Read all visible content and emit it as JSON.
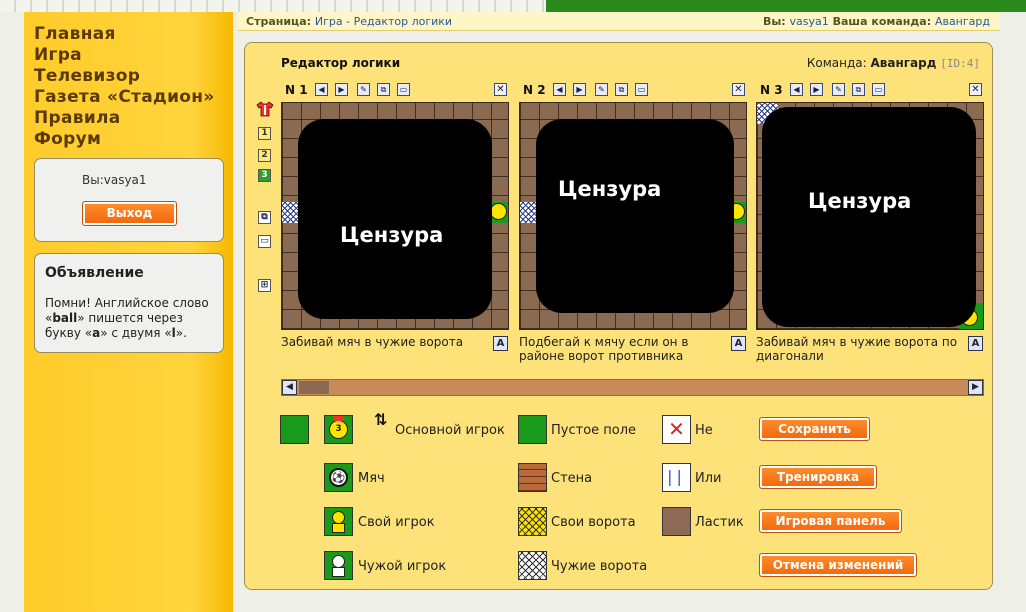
{
  "nav": [
    "Главная",
    "Игра",
    "Телевизор",
    "Газета «Стадион»",
    "Правила",
    "Форум"
  ],
  "user_panel": {
    "username": "Вы:vasya1",
    "logout_label": "Выход"
  },
  "announcement": {
    "title": "Объявление",
    "text_a": "Помни! Английское слово «",
    "text_b": "ball",
    "text_c": "» пишется через букву «",
    "text_d": "a",
    "text_e": "» с двумя «",
    "text_f": "l",
    "text_g": "»."
  },
  "header": {
    "page_label": "Страница:",
    "page_value": "Игра - Редактор логики",
    "you_label": "Вы:",
    "you_value": "vasya1",
    "team_label": "Ваша команда:",
    "team_value": "Авангард"
  },
  "editor": {
    "title": "Редактор логики",
    "team_label": "Команда:",
    "team_name": "Авангард",
    "team_id": "[ID:4]"
  },
  "side_tools": {
    "levels": [
      "1",
      "2",
      "3"
    ],
    "active_level": "3"
  },
  "cards": [
    {
      "number": "N 1",
      "censor": "Цензура",
      "description": "Забивай мяч в чужие ворота"
    },
    {
      "number": "N 2",
      "censor": "Цензура",
      "description": "Подбегай к мячу если он в районе ворот противника"
    },
    {
      "number": "N 3",
      "censor": "Цензура",
      "description": "Забивай мяч в чужие ворота по диагонали"
    }
  ],
  "palette": {
    "main_player": "Основной игрок",
    "ball": "Мяч",
    "own_player": "Свой игрок",
    "enemy_player": "Чужой игрок",
    "empty_field": "Пустое поле",
    "wall": "Стена",
    "own_goal": "Свои ворота",
    "enemy_goal": "Чужие ворота",
    "not": "Не",
    "or": "Или",
    "eraser": "Ластик",
    "main_player_number": "3"
  },
  "buttons": {
    "save": "Сохранить",
    "training": "Тренировка",
    "game_panel": "Игровая панель",
    "cancel": "Отмена изменений"
  },
  "card_action_letter": "A",
  "colors": {
    "sidebar": "#ffcc2a",
    "panel": "#fde27a",
    "field_green": "#1a9a1a",
    "button_orange": "#f0660a"
  }
}
